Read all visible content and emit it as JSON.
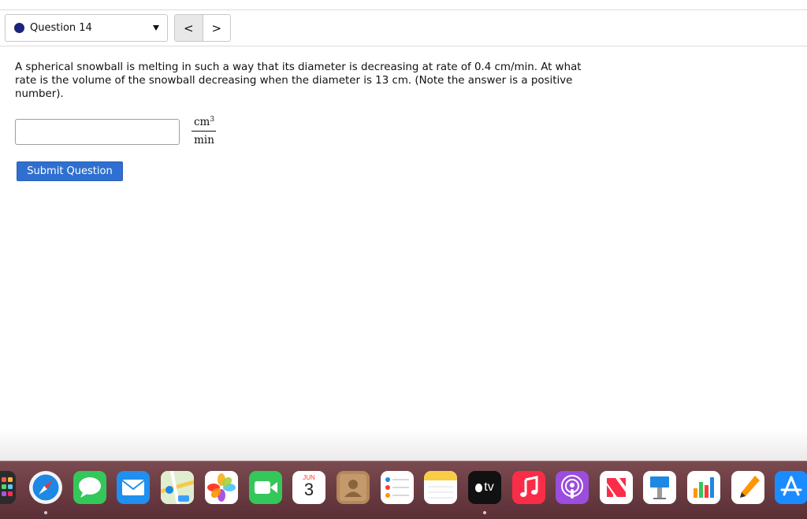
{
  "question_nav": {
    "selected_question": "Question 14",
    "prev_label": "<",
    "next_label": ">"
  },
  "question": {
    "text": "A spherical snowball is melting in such a way that its diameter is decreasing at rate of 0.4 cm/min. At what rate is the volume of the snowball decreasing when the diameter is 13 cm. (Note the answer is a positive number)."
  },
  "answer": {
    "value": "",
    "placeholder": "",
    "unit_numerator": "cm",
    "unit_exponent": "3",
    "unit_denominator": "min"
  },
  "submit": {
    "label": "Submit Question"
  },
  "dock": {
    "calendar_month": "JUN",
    "calendar_day": "3",
    "tv_label": "tv",
    "icons": [
      "launchpad-icon",
      "safari-icon",
      "messages-icon",
      "mail-icon",
      "maps-icon",
      "photos-icon",
      "facetime-icon",
      "calendar-icon",
      "contacts-icon",
      "reminders-icon",
      "notes-icon",
      "apple-tv-icon",
      "music-icon",
      "podcasts-icon",
      "news-icon",
      "keynote-icon",
      "numbers-icon",
      "pages-icon",
      "app-store-icon"
    ]
  },
  "colors": {
    "accent": "#2f6fcf",
    "status_dot": "#1a237e",
    "dock_bg": "#6b3a40"
  }
}
